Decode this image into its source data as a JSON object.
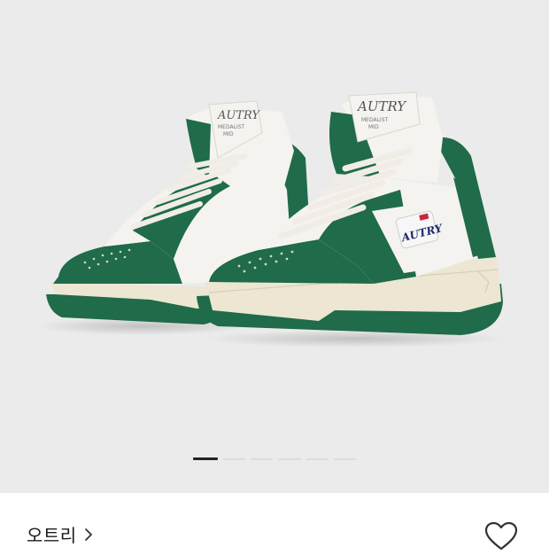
{
  "gallery": {
    "image_alt": "Autry Medalist Mid sneakers, white and green",
    "page_count": 6,
    "active_page": 1,
    "shoe_logo_text": "AUTRY",
    "shoe_tongue_line1": "MEDALIST",
    "shoe_tongue_line2": "MID"
  },
  "product": {
    "brand_name": "오트리",
    "brand_link_icon": "chevron-right-icon",
    "wishlist_icon": "heart-outline-icon"
  },
  "colors": {
    "hero_background": "#ebebeb",
    "shoe_green": "#1f6b4a",
    "shoe_white": "#f4f3ef",
    "sole_cream": "#ece6d3",
    "laces": "#f1ede6"
  }
}
